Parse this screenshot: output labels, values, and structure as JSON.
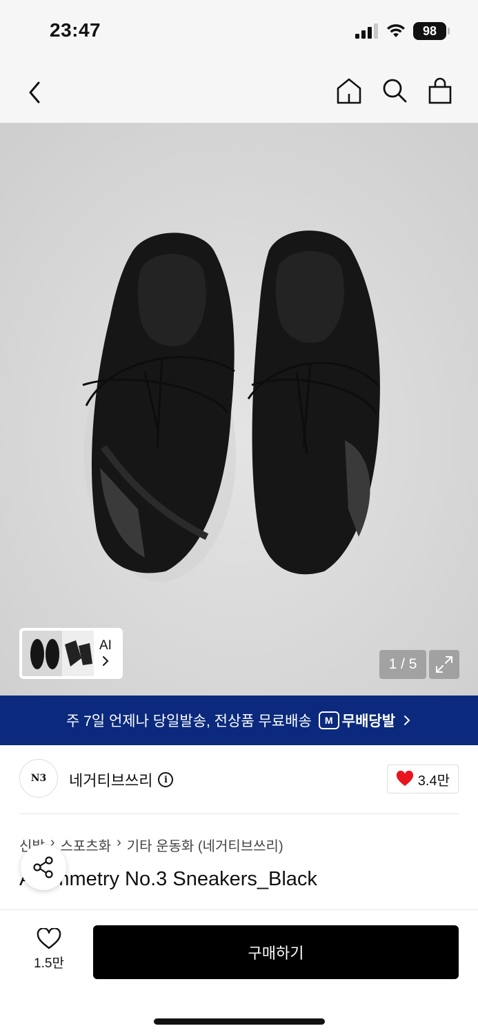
{
  "status": {
    "time": "23:47",
    "battery": "98"
  },
  "nav": {
    "icons": [
      "back-icon",
      "home-icon",
      "search-icon",
      "bag-icon"
    ]
  },
  "gallery": {
    "counter": "1 / 5",
    "ai_label": "AI"
  },
  "promo": {
    "text": "주 7일 언제나 당일발송, 전상품 무료배송",
    "badge_label": "무배당발",
    "badge_icon": "M"
  },
  "brand": {
    "logo_text": "N3",
    "name": "네거티브쓰리",
    "likes": "3.4만"
  },
  "breadcrumb": [
    "신발",
    "스포츠화",
    "기타 운동화 (네거티브쓰리)"
  ],
  "product": {
    "title": "Asymmetry No.3 Sneakers_Black"
  },
  "bottom": {
    "wish_count": "1.5만",
    "buy_label": "구매하기"
  },
  "colors": {
    "promo_bg": "#0b2a7d",
    "heart": "#e8141e",
    "buy_bg": "#000000"
  }
}
